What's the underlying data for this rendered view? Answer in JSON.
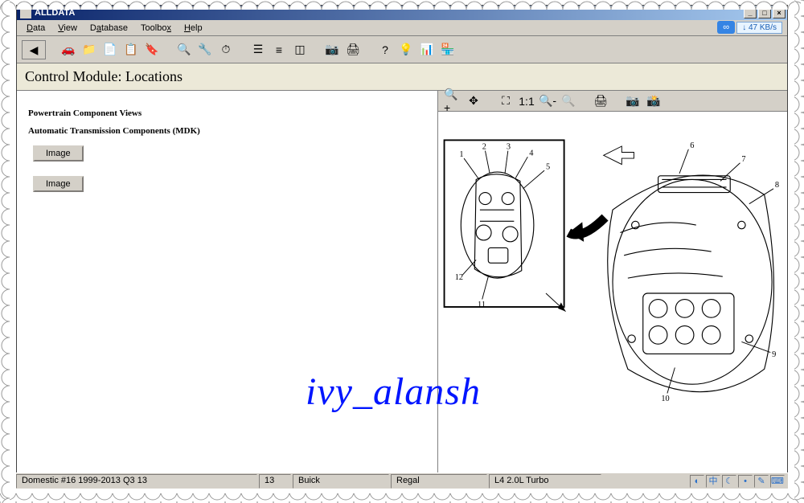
{
  "app": {
    "title": "ALLDATA"
  },
  "menu": {
    "data": "Data",
    "view": "View",
    "database": "Database",
    "toolbox": "Toolbox",
    "help": "Help"
  },
  "speed": {
    "label": "47 KB/s",
    "arrow": "↓"
  },
  "page": {
    "title": "Control Module:  Locations"
  },
  "left": {
    "heading1": "Powertrain Component Views",
    "heading2": "Automatic Transmission Components (MDK)",
    "image_btn": "Image"
  },
  "diagram": {
    "callouts_left": [
      "1",
      "2",
      "3",
      "4",
      "5",
      "11",
      "12"
    ],
    "callouts_right": [
      "6",
      "7",
      "8",
      "9",
      "10"
    ]
  },
  "watermark": {
    "text": "ivy_alansh"
  },
  "status": {
    "cell1": "Domestic #16 1999-2013 Q3 13",
    "cell2": "13",
    "cell3": "Buick",
    "cell4": "Regal",
    "cell5": "L4 2.0L Turbo"
  }
}
